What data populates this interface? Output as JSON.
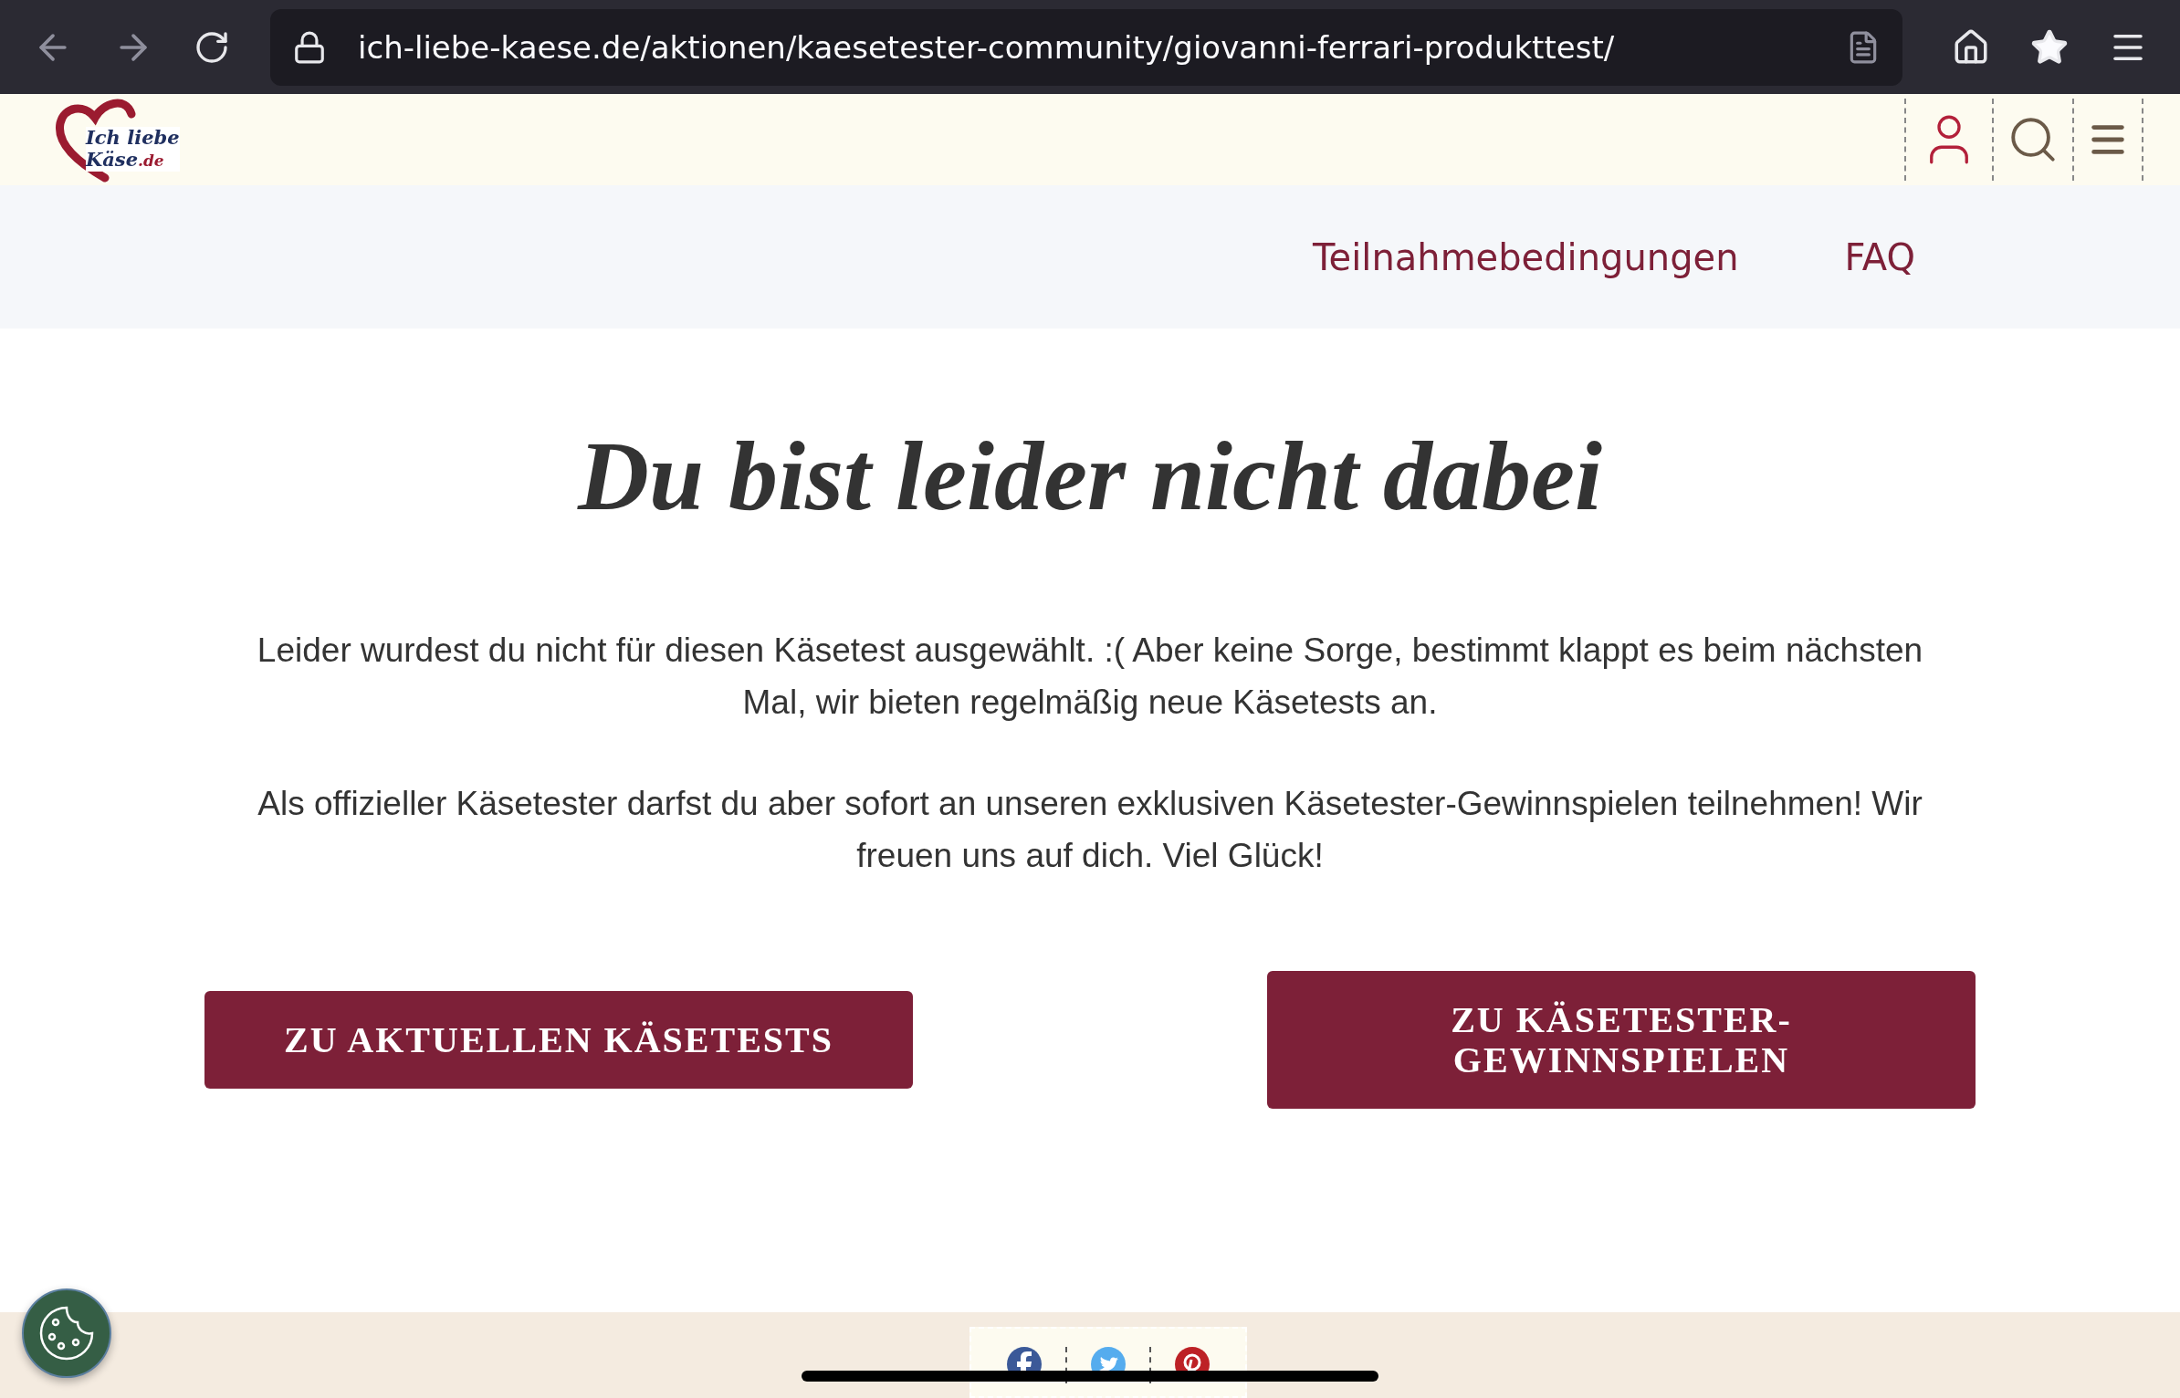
{
  "browser": {
    "url": "ich-liebe-kaese.de/aktionen/kaesetester-community/giovanni-ferrari-produkttest/"
  },
  "logo": {
    "line1": "Ich liebe",
    "line2": "Käse",
    "suffix": ".de"
  },
  "nav": [
    "Teilnahmebedingungen",
    "FAQ"
  ],
  "heading": "Du bist leider nicht dabei",
  "paragraphs": [
    "Leider wurdest du nicht für diesen Käsetest ausgewählt. :( Aber keine Sorge, bestimmt klappt es beim nächsten Mal, wir bieten regelmäßig neue Käsetests an.",
    "Als offizieller Käsetester darfst du aber sofort an unseren exklusiven Käsetester-Gewinnspielen teilnehmen! Wir freuen uns auf dich. Viel Glück!"
  ],
  "buttons": [
    "ZU AKTUELLEN KÄSETESTS",
    "ZU KÄSETESTER-GEWINNSPIELEN"
  ]
}
